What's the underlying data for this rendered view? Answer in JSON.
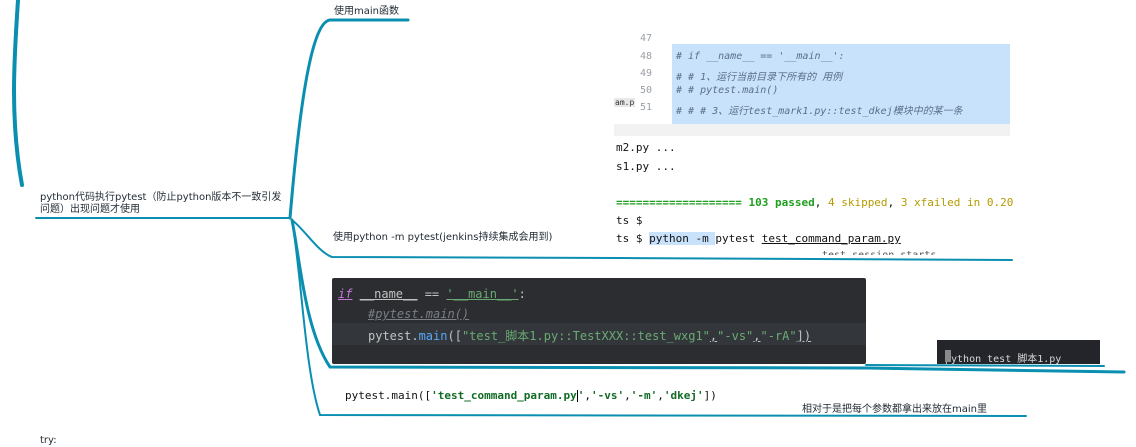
{
  "mindmap": {
    "root_label": "python代码执行pytest（防止python版本不一致引发问题）出现问题才使用",
    "branch_main_label": "使用main函数",
    "branch_cmd_label": "使用python -m pytest(jenkins持续集成会用到)",
    "note_label": "相对于是把每个参数都拿出来放在main里",
    "bottom_label": "try:"
  },
  "editor": {
    "tab_label": "am.p",
    "lines": [
      {
        "num": "47",
        "code": ""
      },
      {
        "num": "48",
        "code": "# if __name__ == '__main__':"
      },
      {
        "num": "49",
        "code": "#     # 1、运行当前目录下所有的 用例"
      },
      {
        "num": "50",
        "code": "#     # pytest.main()"
      },
      {
        "num": "51",
        "code": "#     # # 3、运行test_mark1.py::test_dkej模块中的某一条"
      }
    ]
  },
  "terminal": {
    "line1": "m2.py ...",
    "line2": "s1.py ...",
    "summary_rule": "===================",
    "passed": "103 passed",
    "sep1": ", ",
    "skipped": "4 skipped",
    "sep2": ", ",
    "xfailed": "3 xfailed",
    "in_time": " in 0.20",
    "prompt1": "ts $",
    "prompt2_prefix": "ts $ ",
    "prompt2_sel": "python -m ",
    "prompt2_cmd": "pytest ",
    "prompt2_file": "test_command_param.py",
    "cutoff": "test session starts"
  },
  "dark_code": {
    "line1_if": "if",
    "line1_name": "__name__",
    "line1_eq": " == ",
    "line1_main": "'__main__'",
    "line1_colon": ":",
    "line2": "#pytest.main()",
    "line3_obj": "pytest.",
    "line3_fn": "main",
    "line3_open": "([",
    "line3_arg1": "\"test_脚本1.py::TestXXX::test_wxg1\"",
    "line3_c1": ",",
    "line3_arg2": "\"-vs\"",
    "line3_c2": ",",
    "line3_arg3": "\"-rA\"",
    "line3_close": "])"
  },
  "small_terminal": {
    "text": "python test_脚本1.py"
  },
  "pytest_main_call": {
    "prefix": "pytest.main([",
    "arg1": "'test_command_param.py",
    "after_cursor": "'",
    "c1": ",",
    "arg2": "'-vs'",
    "c2": ",",
    "arg3": "'-m'",
    "c3": ",",
    "arg4": "'dkej'",
    "suffix": "])"
  },
  "colors": {
    "branch": "#0a8fb0",
    "dark_bg": "#2b2d30",
    "keyword": "#c778dd",
    "string_green": "#6aab73",
    "comment": "#7a7e85",
    "function_blue": "#56a8f5",
    "selection": "#c9e2fb"
  }
}
